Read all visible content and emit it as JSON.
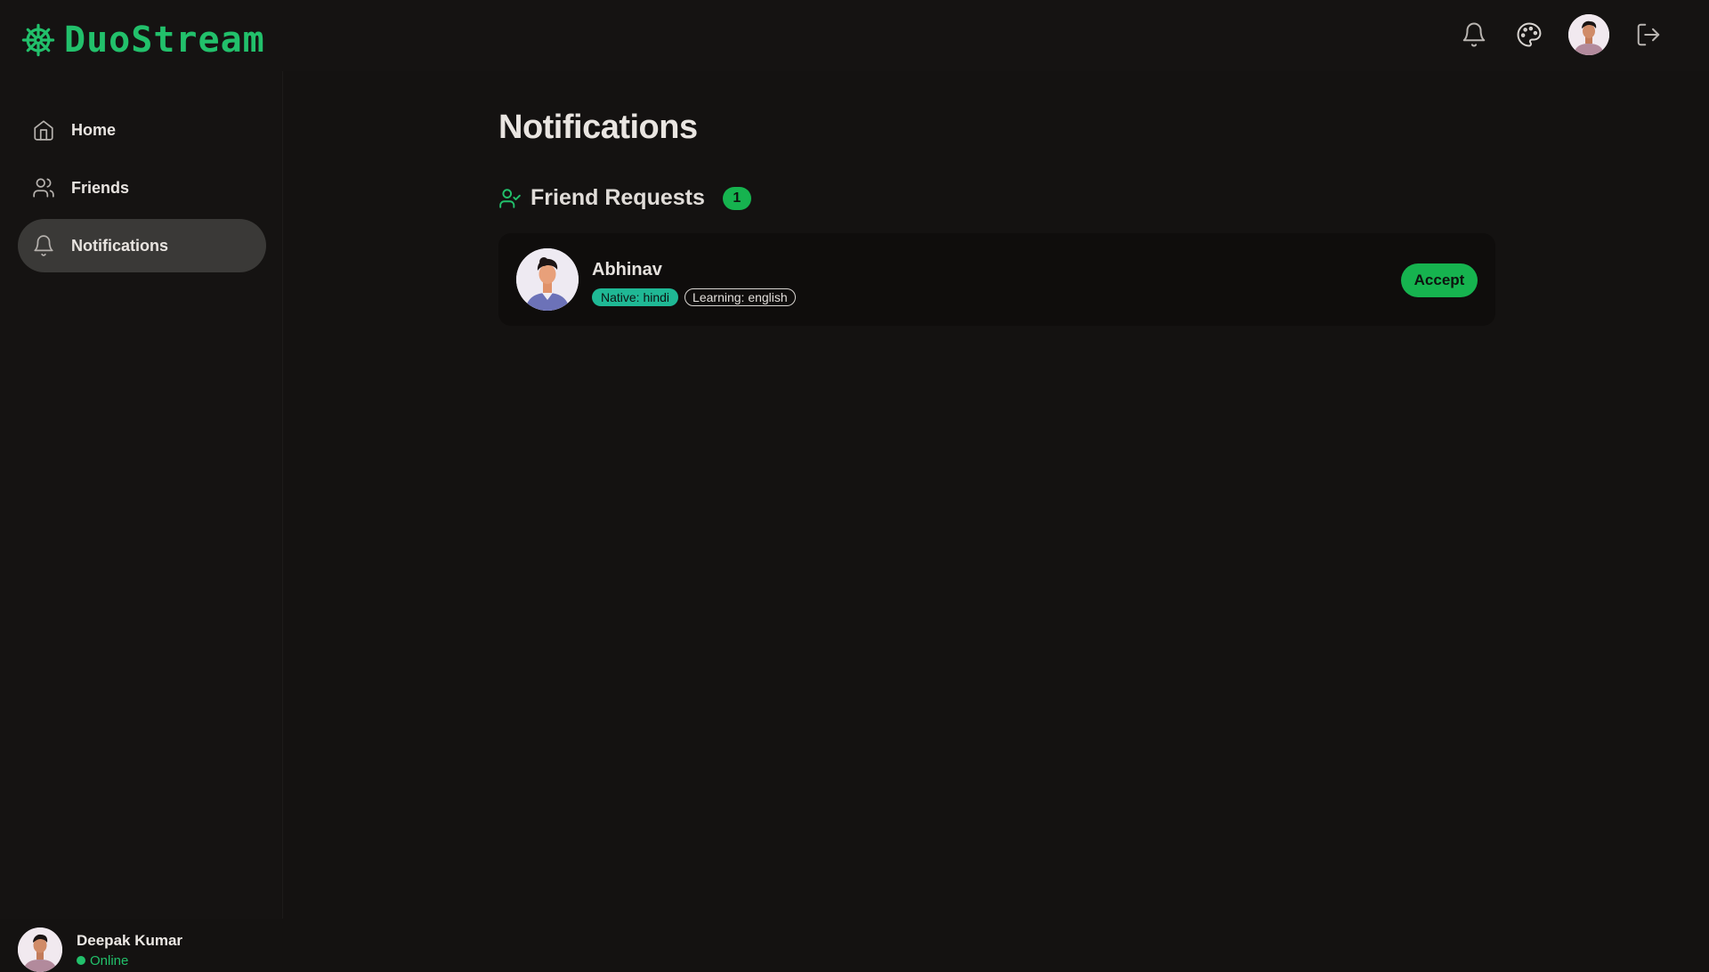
{
  "app": {
    "name": "DuoStream",
    "brand_color": "#22c06b"
  },
  "topbar": {
    "icons": [
      "bell-icon",
      "palette-icon",
      "avatar",
      "logout-icon"
    ]
  },
  "sidebar": {
    "items": [
      {
        "label": "Home",
        "icon": "home-icon",
        "active": false
      },
      {
        "label": "Friends",
        "icon": "users-icon",
        "active": false
      },
      {
        "label": "Notifications",
        "icon": "bell-icon",
        "active": true
      }
    ],
    "user": {
      "name": "Deepak Kumar",
      "status": "Online"
    }
  },
  "main": {
    "title": "Notifications",
    "friend_requests": {
      "title": "Friend Requests",
      "count": "1",
      "items": [
        {
          "name": "Abhinav",
          "native": "Native: hindi",
          "learning": "Learning: english",
          "action": "Accept"
        }
      ]
    }
  }
}
